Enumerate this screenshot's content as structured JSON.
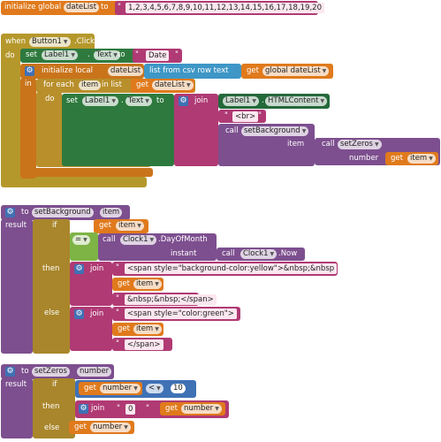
{
  "global_block": {
    "initialize_global": "initialize global",
    "name": "dateList",
    "to": "to",
    "value": "1,2,3,4,5,6,7,8,9,10,11,12,13,14,15,16,17,18,19,20"
  },
  "event_block": {
    "when": "when",
    "component": "Button1",
    "event": ".Click",
    "do": "do"
  },
  "set_text": {
    "set": "set",
    "component": "Label1",
    "prop": "Text",
    "to": "to",
    "value": "Date"
  },
  "init_local": {
    "label": "initialize local",
    "name": "dateList",
    "to": "to",
    "in": "in",
    "csv": "list from csv row text",
    "get": "get",
    "global_var": "global dateList"
  },
  "for_each": {
    "label": "for each",
    "item": "item",
    "in_list": "in list",
    "get": "get",
    "var": "dateList",
    "do": "do"
  },
  "set_inner": {
    "set": "set",
    "component": "Label1",
    "prop": "Text",
    "to": "to",
    "join": "join",
    "label1": "Label1",
    "html": "HTMLContent",
    "br": "<br>",
    "call": "call",
    "proc": "setBackground",
    "item": "item",
    "call2": "call",
    "proc2": "setZeros",
    "number": "number",
    "get": "get",
    "var": "item"
  },
  "proc_bg": {
    "to": "to",
    "name": "setBackground",
    "param": "item",
    "result": "result",
    "if": "if",
    "then": "then",
    "else": "else",
    "get": "get",
    "var": "item",
    "eq": "=",
    "call": "call",
    "clock": "Clock1",
    "dom": ".DayOfMonth",
    "instant": "instant",
    "call2": "call",
    "clock2": "Clock1",
    "now": ".Now",
    "join": "join",
    "span_open": "<span style=\"background-color:yellow\">&nbsp;&nbsp",
    "nbsp_close": "&nbsp;&nbsp;</span>",
    "span_green": "<span style=\"color:green\">",
    "span_close": "</span>"
  },
  "proc_zeros": {
    "to": "to",
    "name": "setZeros",
    "param": "number",
    "result": "result",
    "if": "if",
    "then": "then",
    "else": "else",
    "get": "get",
    "var": "number",
    "lt": "<",
    "ten": "10",
    "join": "join",
    "zero": "0"
  }
}
